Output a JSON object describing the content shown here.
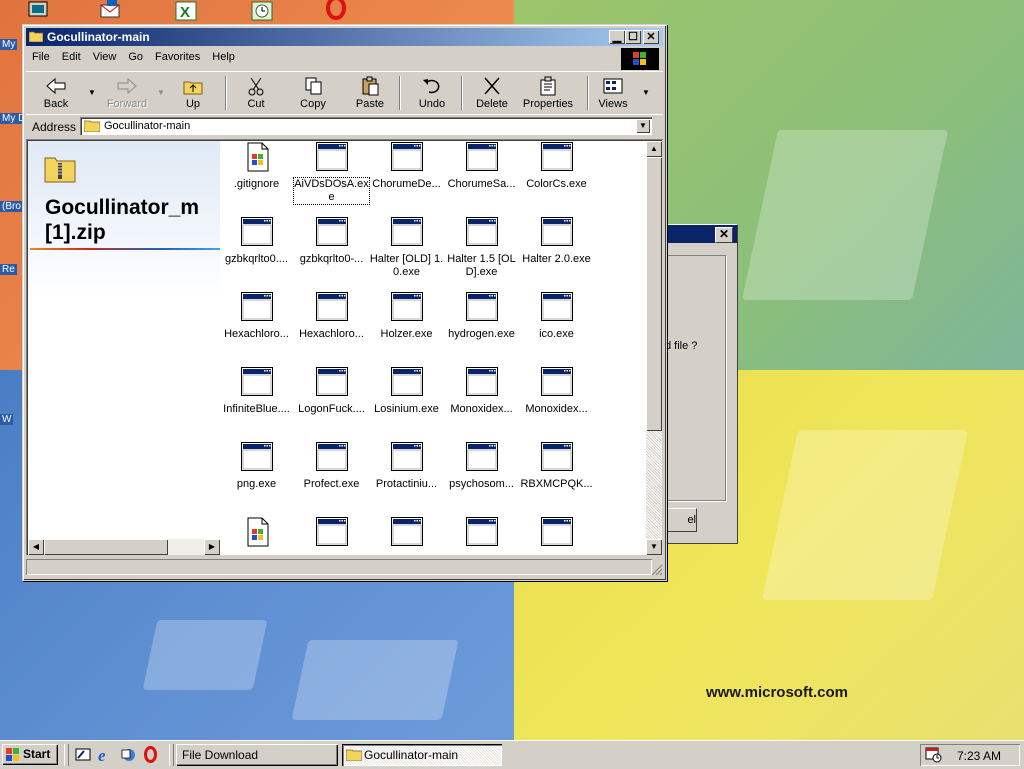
{
  "desktop": {
    "wallpaper_url": "www.microsoft.com",
    "icon_labels": [
      "My",
      "My D",
      "(Bro",
      "Re",
      "W"
    ]
  },
  "background_dialog": {
    "partial_text": "d file ?",
    "partial_button": "el"
  },
  "explorer": {
    "title": "Gocullinator-main",
    "menus": [
      "File",
      "Edit",
      "View",
      "Go",
      "Favorites",
      "Help"
    ],
    "toolbar": {
      "back": "Back",
      "forward": "Forward",
      "up": "Up",
      "cut": "Cut",
      "copy": "Copy",
      "paste": "Paste",
      "undo": "Undo",
      "delete": "Delete",
      "properties": "Properties",
      "views": "Views"
    },
    "address": {
      "label": "Address",
      "value": "Gocullinator-main"
    },
    "folder_panel_title": "Gocullinator_m\n[1].zip",
    "files": [
      {
        "name": ".gitignore",
        "icon": "text-document-icon"
      },
      {
        "name": "AiVDsDOsA.exe",
        "icon": "exe-window-icon",
        "focused": true
      },
      {
        "name": "ChorumeDe...",
        "icon": "exe-window-icon"
      },
      {
        "name": "ChorumeSa...",
        "icon": "exe-window-icon"
      },
      {
        "name": "ColorCs.exe",
        "icon": "exe-window-icon"
      },
      {
        "name": "gzbkqrlto0....",
        "icon": "exe-window-icon"
      },
      {
        "name": "gzbkqrlto0-...",
        "icon": "exe-window-icon"
      },
      {
        "name": "Halter [OLD] 1.0.exe",
        "icon": "exe-window-icon"
      },
      {
        "name": "Halter 1.5 [OLD].exe",
        "icon": "exe-window-icon"
      },
      {
        "name": "Halter 2.0.exe",
        "icon": "exe-window-icon"
      },
      {
        "name": "Hexachloro...",
        "icon": "exe-window-icon"
      },
      {
        "name": "Hexachloro...",
        "icon": "exe-window-icon"
      },
      {
        "name": "Holzer.exe",
        "icon": "exe-window-icon"
      },
      {
        "name": "hydrogen.exe",
        "icon": "exe-window-icon"
      },
      {
        "name": "ico.exe",
        "icon": "exe-window-icon"
      },
      {
        "name": "InfiniteBlue....",
        "icon": "exe-window-icon"
      },
      {
        "name": "LogonFuck....",
        "icon": "exe-window-icon"
      },
      {
        "name": "Losinium.exe",
        "icon": "exe-window-icon"
      },
      {
        "name": "Monoxidex...",
        "icon": "exe-window-icon"
      },
      {
        "name": "Monoxidex...",
        "icon": "exe-window-icon"
      },
      {
        "name": "png.exe",
        "icon": "exe-window-icon"
      },
      {
        "name": "Profect.exe",
        "icon": "exe-window-icon"
      },
      {
        "name": "Protactiniu...",
        "icon": "exe-window-icon"
      },
      {
        "name": "psychosom...",
        "icon": "exe-window-icon"
      },
      {
        "name": "RBXMCPQK...",
        "icon": "exe-window-icon"
      },
      {
        "name": "",
        "icon": "text-document-icon"
      },
      {
        "name": "",
        "icon": "exe-window-icon"
      },
      {
        "name": "",
        "icon": "exe-window-icon"
      },
      {
        "name": "",
        "icon": "exe-window-icon"
      },
      {
        "name": "",
        "icon": "exe-window-icon"
      }
    ]
  },
  "taskbar": {
    "start_label": "Start",
    "tasks": [
      {
        "label": "File Download",
        "active": false
      },
      {
        "label": "Gocullinator-main",
        "active": true
      }
    ],
    "clock": "7:23 AM"
  },
  "colors": {
    "title_active_start": "#0a246a",
    "title_active_end": "#a6caf0",
    "face": "#d4d0c8",
    "exe_icon_titlebar": "#0a246a"
  }
}
